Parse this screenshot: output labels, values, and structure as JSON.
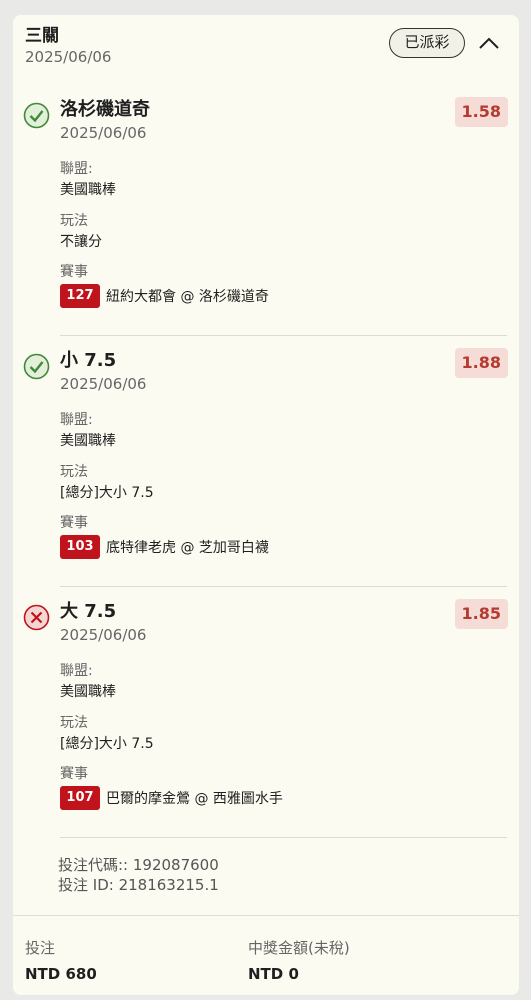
{
  "header": {
    "title": "三關",
    "date": "2025/06/06",
    "status_pill": "已派彩"
  },
  "legs": [
    {
      "status": "won",
      "status_icon": "check-circle-icon",
      "name": "洛杉磯道奇",
      "date": "2025/06/06",
      "odds": "1.58",
      "league_label": "聯盟:",
      "league": "美國職棒",
      "bet_type_label": "玩法",
      "bet_type": "不讓分",
      "event_label": "賽事",
      "match_no": "127",
      "match": "紐約大都會 @ 洛杉磯道奇"
    },
    {
      "status": "won",
      "status_icon": "check-circle-icon",
      "name": "小 7.5",
      "date": "2025/06/06",
      "odds": "1.88",
      "league_label": "聯盟:",
      "league": "美國職棒",
      "bet_type_label": "玩法",
      "bet_type": "[總分]大小 7.5",
      "event_label": "賽事",
      "match_no": "103",
      "match": "底特律老虎 @ 芝加哥白襪"
    },
    {
      "status": "lost",
      "status_icon": "x-circle-icon",
      "name": "大 7.5",
      "date": "2025/06/06",
      "odds": "1.85",
      "league_label": "聯盟:",
      "league": "美國職棒",
      "bet_type_label": "玩法",
      "bet_type": "[總分]大小 7.5",
      "event_label": "賽事",
      "match_no": "107",
      "match": "巴爾的摩金鶯 @ 西雅圖水手"
    }
  ],
  "codes": {
    "bet_code": "投注代碼:: 192087600",
    "bet_id": "投注 ID: 218163215.1"
  },
  "footer": {
    "stake_label": "投注",
    "stake_value": "NTD 680",
    "payout_label": "中獎金額(未稅)",
    "payout_value": "NTD 0"
  },
  "colors": {
    "won": "#3f8a3a",
    "lost": "#c0131b",
    "odds_bg": "#f6dcd6",
    "odds_text": "#b53a2f",
    "card_bg": "#fcfbf2"
  }
}
